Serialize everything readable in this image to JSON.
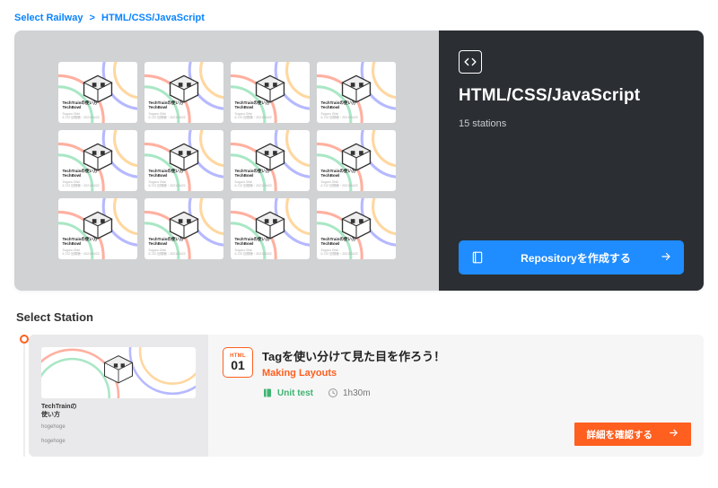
{
  "breadcrumbs": {
    "root": "Select Railway",
    "sep": ">",
    "current": "HTML/CSS/JavaScript"
  },
  "hero": {
    "title": "HTML/CSS/JavaScript",
    "stations": "15 stations",
    "repo_button": "Repositoryを作成する",
    "mini_card": {
      "line1": "TechTrainの使い方",
      "line2": "TechBowl",
      "line3": "Suguru Ohki",
      "line4": "6,722 回視聴・2021/04/22"
    }
  },
  "section": {
    "title": "Select Station"
  },
  "station": {
    "badge_lang": "HTML",
    "badge_num": "01",
    "title": "Tagを使い分けて見た目を作ろう！",
    "subtitle": "Making Layouts",
    "meta": {
      "unit_test": "Unit test",
      "duration": "1h30m"
    },
    "thumb": {
      "line1": "TechTrainの",
      "line2": "使い方",
      "author": "hogehoge",
      "footer": "hogehoge"
    },
    "detail_button": "詳細を確認する"
  }
}
